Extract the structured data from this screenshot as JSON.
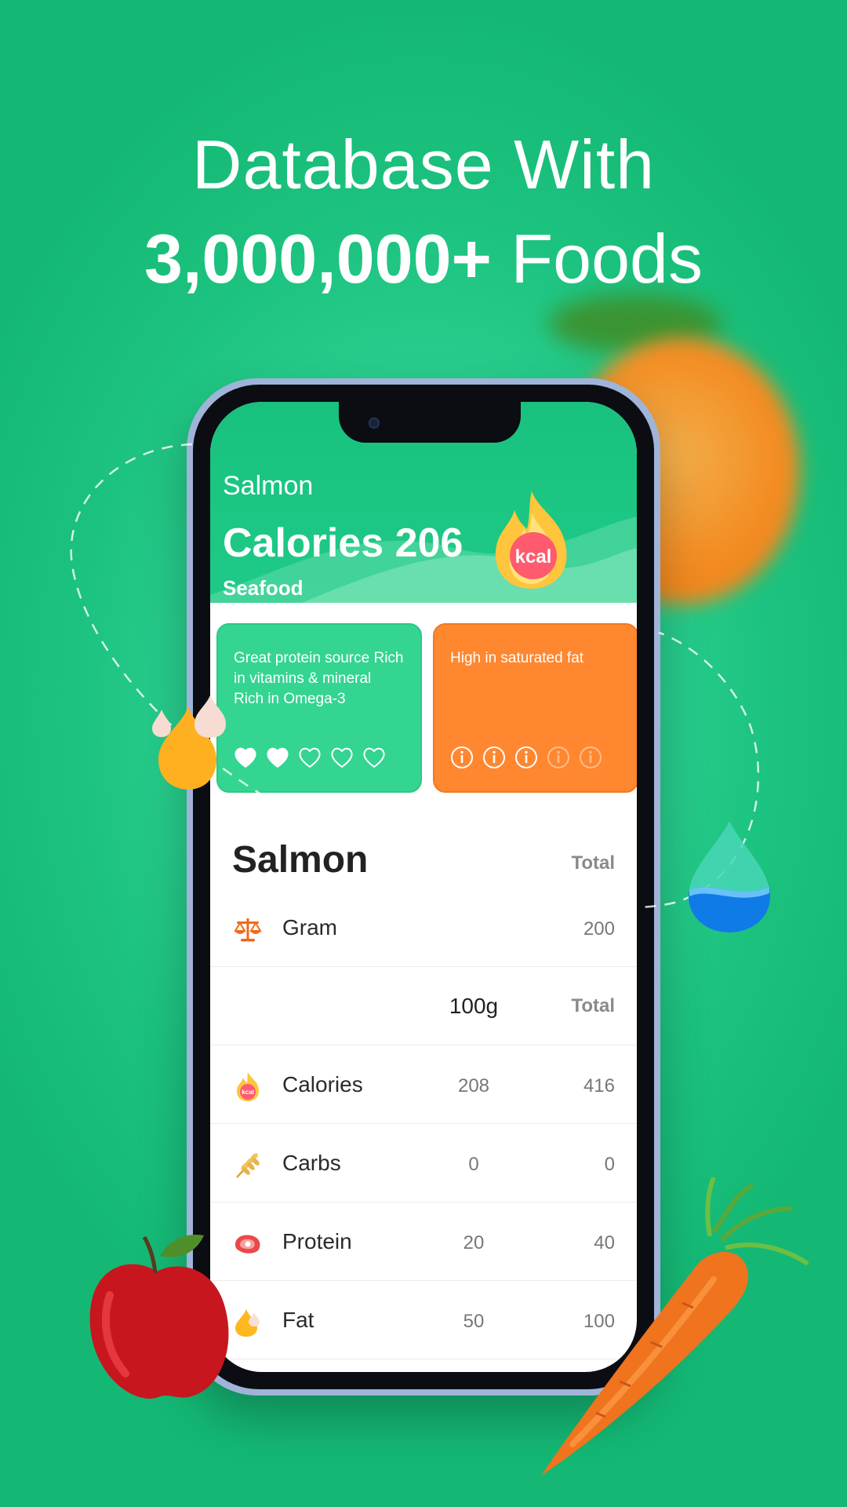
{
  "headline": {
    "line1": "Database With",
    "line2_bold": "3,000,000+",
    "line2_rest": " Foods"
  },
  "food_header": {
    "name": "Salmon",
    "calories_text": "Calories 206",
    "category": "Seafood",
    "badge": "kcal"
  },
  "cards": {
    "positive": {
      "text": "Great protein source Rich in vitamins & mineral Rich in Omega-3",
      "rating_filled": 2,
      "rating_total": 5
    },
    "negative": {
      "text": "High in saturated fat",
      "rating_filled": 3,
      "rating_total": 5
    }
  },
  "detail": {
    "title": "Salmon",
    "total_label": "Total",
    "gram_row": {
      "label": "Gram",
      "total": "200"
    },
    "subheader": {
      "per": "100g",
      "total": "Total"
    },
    "nutrients": [
      {
        "label": "Calories",
        "per100": "208",
        "total": "416",
        "icon": "kcal-fire-icon"
      },
      {
        "label": "Carbs",
        "per100": "0",
        "total": "0",
        "icon": "wheat-icon"
      },
      {
        "label": "Protein",
        "per100": "20",
        "total": "40",
        "icon": "meat-icon"
      },
      {
        "label": "Fat",
        "per100": "50",
        "total": "100",
        "icon": "oil-drop-icon"
      }
    ]
  },
  "colors": {
    "brand_green": "#1fc987",
    "card_green": "#33d591",
    "card_orange": "#ff8730",
    "scale_icon": "#f06a1a"
  }
}
